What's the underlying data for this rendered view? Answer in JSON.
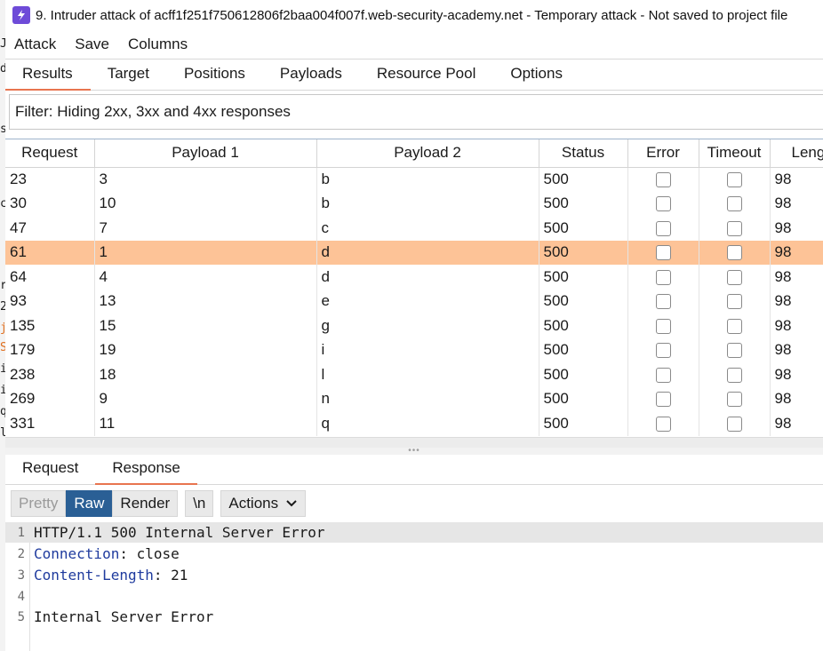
{
  "window": {
    "title": "9. Intruder attack of acff1f251f750612806f2baa004f007f.web-security-academy.net - Temporary attack - Not saved to project file"
  },
  "menu": [
    "Attack",
    "Save",
    "Columns"
  ],
  "tabs": [
    "Results",
    "Target",
    "Positions",
    "Payloads",
    "Resource Pool",
    "Options"
  ],
  "filter": {
    "text": "Filter: Hiding 2xx, 3xx and 4xx responses"
  },
  "table": {
    "columns": [
      "Request",
      "Payload 1",
      "Payload 2",
      "Status",
      "Error",
      "Timeout",
      "Length"
    ],
    "rows": [
      {
        "request": "23",
        "p1": "3",
        "p2": "b",
        "status": "500",
        "length": "98"
      },
      {
        "request": "30",
        "p1": "10",
        "p2": "b",
        "status": "500",
        "length": "98"
      },
      {
        "request": "47",
        "p1": "7",
        "p2": "c",
        "status": "500",
        "length": "98"
      },
      {
        "request": "61",
        "p1": "1",
        "p2": "d",
        "status": "500",
        "length": "98",
        "selected": true
      },
      {
        "request": "64",
        "p1": "4",
        "p2": "d",
        "status": "500",
        "length": "98"
      },
      {
        "request": "93",
        "p1": "13",
        "p2": "e",
        "status": "500",
        "length": "98"
      },
      {
        "request": "135",
        "p1": "15",
        "p2": "g",
        "status": "500",
        "length": "98"
      },
      {
        "request": "179",
        "p1": "19",
        "p2": "i",
        "status": "500",
        "length": "98"
      },
      {
        "request": "238",
        "p1": "18",
        "p2": "l",
        "status": "500",
        "length": "98"
      },
      {
        "request": "269",
        "p1": "9",
        "p2": "n",
        "status": "500",
        "length": "98"
      },
      {
        "request": "331",
        "p1": "11",
        "p2": "q",
        "status": "500",
        "length": "98"
      }
    ]
  },
  "subtabs": [
    "Request",
    "Response"
  ],
  "toolbar": {
    "pretty": "Pretty",
    "raw": "Raw",
    "render": "Render",
    "newline": "\\n",
    "actions": "Actions"
  },
  "response": {
    "lines": [
      {
        "num": "1",
        "name": "",
        "value": "HTTP/1.1 500 Internal Server Error"
      },
      {
        "num": "2",
        "name": "Connection",
        "value": "close"
      },
      {
        "num": "3",
        "name": "Content-Length",
        "value": "21"
      },
      {
        "num": "4",
        "name": "",
        "value": ""
      },
      {
        "num": "5",
        "name": "",
        "value": "Internal Server Error"
      }
    ]
  },
  "colors": {
    "accent": "#e8744f",
    "selected_row": "#fdc397",
    "active_button": "#2a5f95",
    "app_icon": "#6e4bd8"
  }
}
